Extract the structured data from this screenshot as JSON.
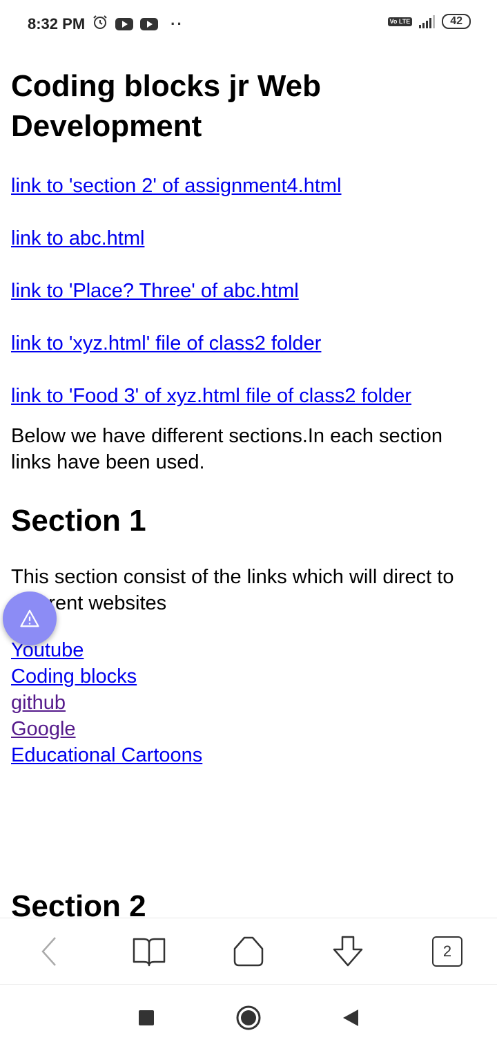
{
  "status": {
    "time": "8:32 PM",
    "network": "4G",
    "volte": "Vo LTE",
    "battery": "42"
  },
  "page": {
    "title": "Coding blocks jr Web Development",
    "links": [
      "link to 'section 2' of assignment4.html",
      "link to abc.html",
      "link to 'Place? Three' of abc.html",
      "link to 'xyz.html' file of class2 folder",
      "link to 'Food 3' of xyz.html file of class2 folder"
    ],
    "intro": "Below we have different sections.In each section links have been used.",
    "section1": {
      "heading": "Section 1",
      "text": "This section consist of the links which will direct to different websites",
      "links": [
        "Youtube",
        "Coding blocks",
        "github",
        "Google",
        "Educational Cartoons"
      ]
    },
    "section2": {
      "heading": "Section 2"
    }
  },
  "toolbar": {
    "tab_count": "2"
  },
  "colors": {
    "link": "#0000ee",
    "visited_link": "#551a8b",
    "fab": "#8c8cf5"
  }
}
